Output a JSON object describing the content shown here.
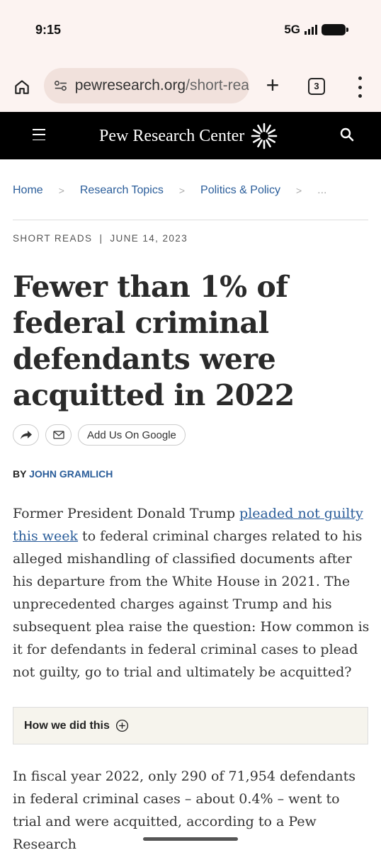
{
  "status_bar": {
    "time": "9:15",
    "network": "5G"
  },
  "browser": {
    "url_domain": "pewresearch.org",
    "url_path": "/short-rea",
    "tab_count": "3"
  },
  "site": {
    "logo_text": "Pew Research Center"
  },
  "breadcrumb": {
    "items": [
      "Home",
      "Research Topics",
      "Politics & Policy"
    ],
    "separator": ">",
    "more": "..."
  },
  "article": {
    "section": "SHORT READS",
    "meta_separator": "|",
    "date": "JUNE 14, 2023",
    "title": "Fewer than 1% of federal criminal defendants were acquitted in 2022",
    "add_google_label": "Add Us On Google",
    "byline_prefix": "BY",
    "author": "JOHN GRAMLICH",
    "para1_start": "Former President Donald Trump ",
    "para1_link": "pleaded not guilty this week",
    "para1_rest": " to federal criminal charges related to his alleged mishandling of classified documents after his departure from the White House in 2021. The unprecedented charges against Trump and his subsequent plea raise the question: How common is it for defendants in federal criminal cases to plead not guilty, go to trial and ultimately be acquitted?",
    "how_we_did_this": "How we did this",
    "para2": "In fiscal year 2022, only 290 of 71,954 defendants in federal criminal cases – about 0.4% – went to trial and were acquitted, according to a Pew Research"
  },
  "icons": {
    "home": "home-icon",
    "site_settings": "tune-icon",
    "new_tab": "plus-icon",
    "more": "more-vert-icon",
    "menu": "hamburger-icon",
    "search": "search-icon",
    "share": "share-icon",
    "email": "mail-icon",
    "expand": "plus-circle-icon"
  }
}
